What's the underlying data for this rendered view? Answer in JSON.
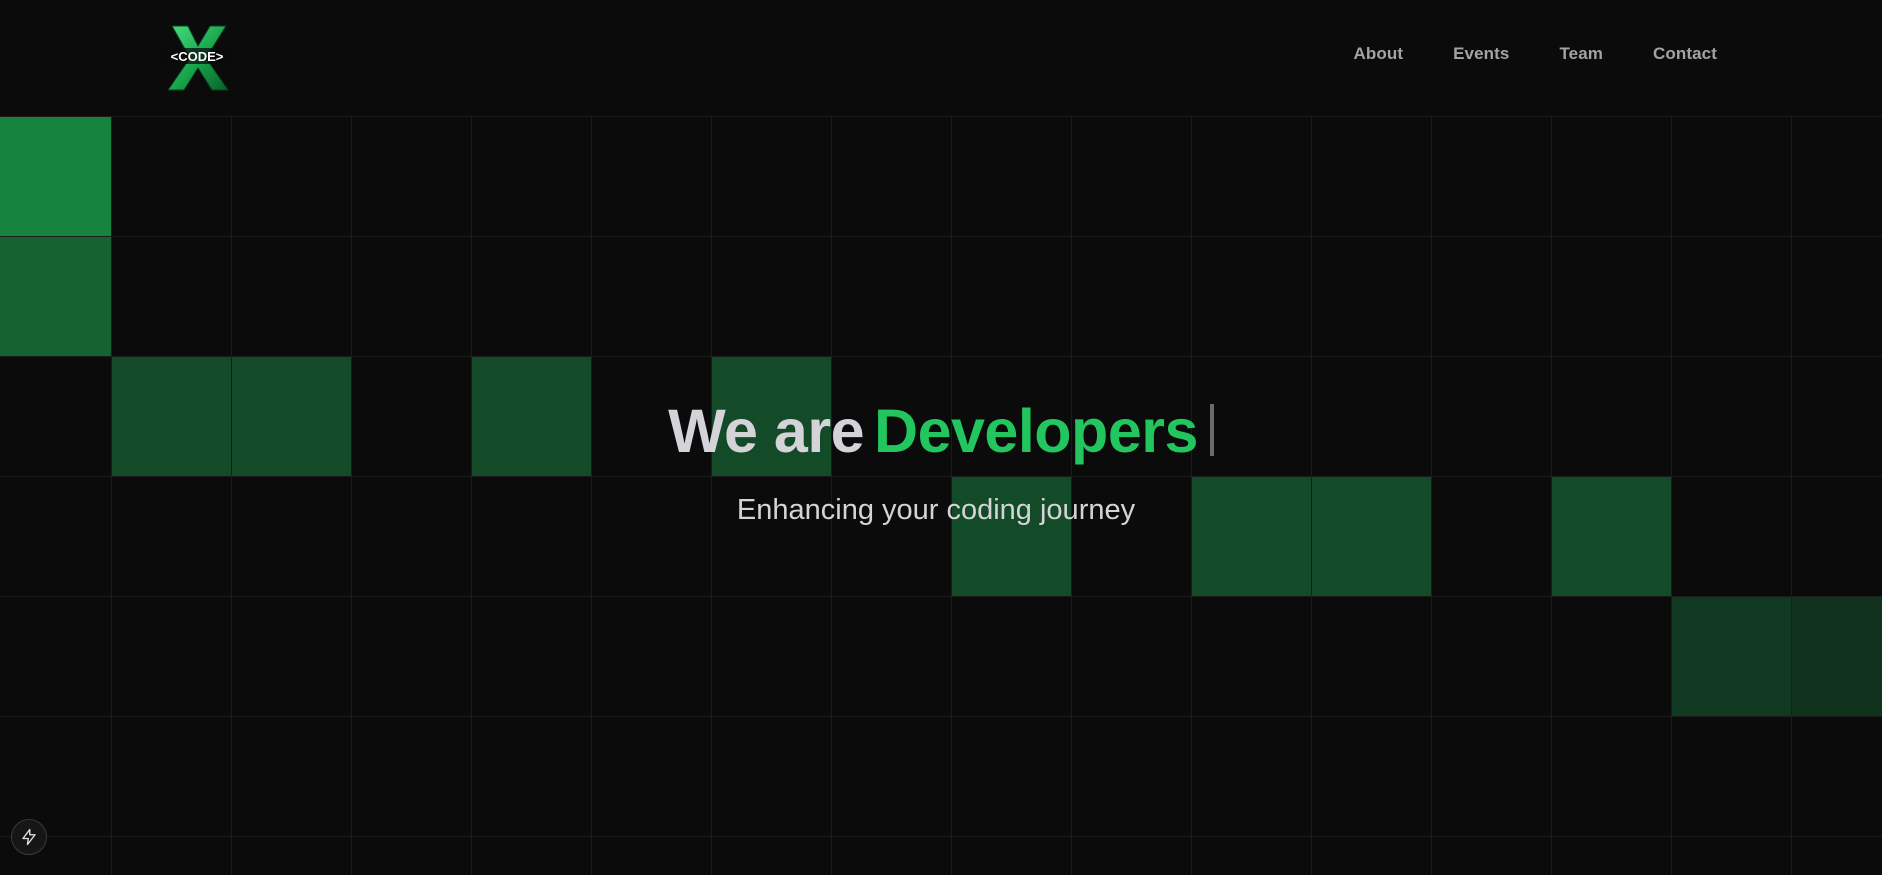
{
  "header": {
    "logo": {
      "text": "<CODE>",
      "icon": "x-logo-icon",
      "accent": "#22c55e"
    },
    "nav": [
      {
        "label": "About"
      },
      {
        "label": "Events"
      },
      {
        "label": "Team"
      },
      {
        "label": "Contact"
      }
    ]
  },
  "hero": {
    "prefix": "We are",
    "highlight": "Developers",
    "subtitle": "Enhancing your coding journey"
  },
  "grid": {
    "background": "#0b0b0b",
    "line_color": "#1c1c1c",
    "highlighted_cells": [
      {
        "col": 0,
        "row": 0,
        "color": "#16833e"
      },
      {
        "col": 0,
        "row": 1,
        "color": "#166331"
      },
      {
        "col": 1,
        "row": 2,
        "color": "#134a28"
      },
      {
        "col": 2,
        "row": 2,
        "color": "#134a28"
      },
      {
        "col": 4,
        "row": 2,
        "color": "#134a28"
      },
      {
        "col": 6,
        "row": 2,
        "color": "#134a28"
      },
      {
        "col": 8,
        "row": 3,
        "color": "#134a28"
      },
      {
        "col": 10,
        "row": 3,
        "color": "#134a28"
      },
      {
        "col": 11,
        "row": 3,
        "color": "#134a28"
      },
      {
        "col": 13,
        "row": 3,
        "color": "#134a28"
      },
      {
        "col": 14,
        "row": 4,
        "color": "#113820"
      },
      {
        "col": 15,
        "row": 4,
        "color": "#11331e"
      }
    ]
  },
  "fab": {
    "icon": "lightning-icon"
  },
  "colors": {
    "accent": "#22c55e",
    "text": "#d4d4d8",
    "nav_text": "#a3a3a3"
  }
}
